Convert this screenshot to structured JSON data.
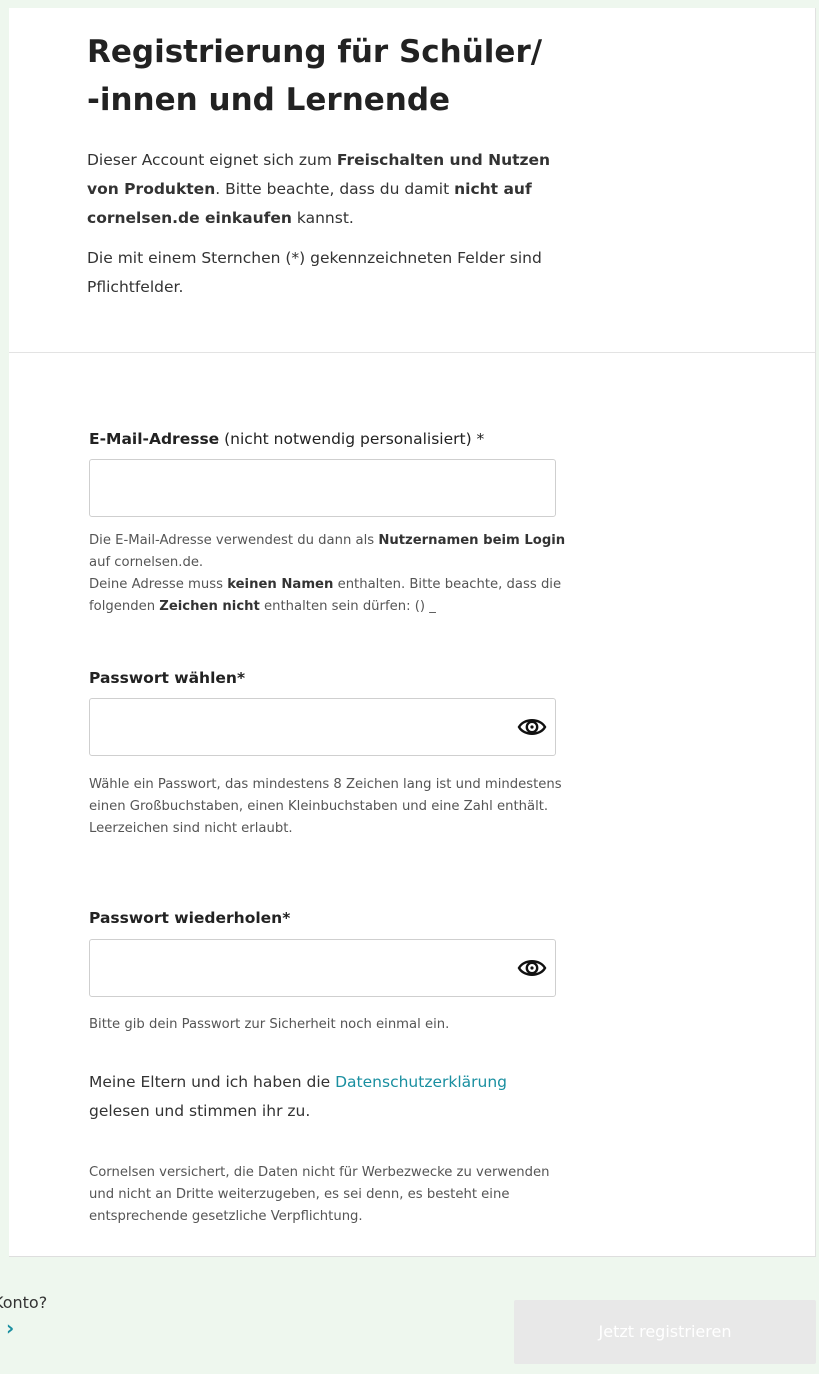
{
  "header": {
    "title_line1": "Registrierung für Schüler/",
    "title_line2": "-innen und Lernende",
    "intro_1": "Dieser Account eignet sich zum ",
    "intro_bold_1": "Freischalten und Nutzen von Produkten",
    "intro_2": ". Bitte beachte, dass du damit ",
    "intro_bold_2": "nicht auf cornelsen.de einkaufen",
    "intro_3": " kannst.",
    "required_note": "Die mit einem Sternchen (*) gekennzeichneten Felder sind Pflichtfelder."
  },
  "email": {
    "label_bold": "E-Mail-Adresse",
    "label_rest": " (nicht notwendig personalisiert) *",
    "value": "",
    "help_1": "Die E-Mail-Adresse verwendest du dann als ",
    "help_bold_1": "Nutzernamen beim Login",
    "help_2": " auf cornelsen.de.",
    "help_3": "Deine Adresse muss ",
    "help_bold_2": "keinen Namen",
    "help_4": " enthalten. Bitte beachte, dass die folgenden ",
    "help_bold_3": "Zeichen nicht",
    "help_5": " enthalten sein dürfen: () _"
  },
  "password": {
    "label": "Passwort wählen*",
    "value": "",
    "help": "Wähle ein Passwort, das mindestens 8 Zeichen lang ist und mindestens einen Großbuchstaben, einen Kleinbuchstaben und eine Zahl enthält. Leerzeichen sind nicht erlaubt.",
    "toggle_icon": "eye-icon"
  },
  "password_repeat": {
    "label": "Passwort wiederholen*",
    "value": "",
    "help": "Bitte gib dein Passwort zur Sicherheit noch einmal ein.",
    "toggle_icon": "eye-icon"
  },
  "consent": {
    "text_1": "Meine Eltern und ich haben die ",
    "link": "Datenschutzerklärung",
    "text_2": " gelesen und stimmen ihr zu.",
    "disclaimer": "Cornelsen versichert, die Daten nicht für Werbezwecke zu verwenden und nicht an Dritte weiterzugeben, es sei denn, es besteht eine entsprechende gesetzliche Verpflichtung."
  },
  "footer": {
    "konto_text": "Konto?",
    "link_icon": "chevron-right-icon",
    "submit_label": "Jetzt registrieren"
  },
  "colors": {
    "link": "#1a8fa0",
    "submit_disabled_bg": "#e8e8e8",
    "page_bg": "#eef7ee"
  }
}
